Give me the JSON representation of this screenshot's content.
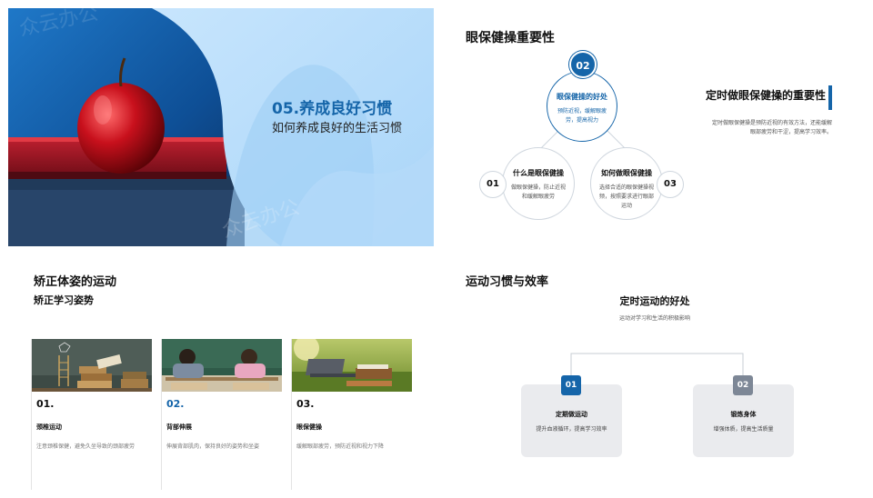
{
  "hero": {
    "watermark": "众云办公",
    "title": "05.养成良好习惯",
    "subtitle": "如何养成良好的生活习惯"
  },
  "importance": {
    "title": "眼保健操重要性",
    "nodes": [
      {
        "num": "01",
        "title": "什么是眼保健操",
        "desc": "做眼保健操，防止近视和缓解眼疲劳"
      },
      {
        "num": "02",
        "title": "眼保健操的好处",
        "desc": "预防近视，缓解眼疲劳，提高视力"
      },
      {
        "num": "03",
        "title": "如何做眼保健操",
        "desc": "选择合适的眼保健操视频，按照要求进行眼部运动"
      }
    ],
    "side_title": "定时做眼保健操的重要性",
    "side_text": "定时做眼保健操是预防近视的有效方法，还能缓解眼部疲劳和干涩，提高学习效率。"
  },
  "posture": {
    "title": "矫正体姿的运动",
    "subtitle": "矫正学习姿势",
    "cards": [
      {
        "num": "01.",
        "name": "颈椎运动",
        "desc": "注意颈椎保健，避免久坐导致的颈部疲劳"
      },
      {
        "num": "02.",
        "name": "背部伸展",
        "desc": "伸展背部肌肉，保持良好的姿势和坐姿"
      },
      {
        "num": "03.",
        "name": "眼保健操",
        "desc": "缓解眼部疲劳，预防近视和视力下降"
      }
    ]
  },
  "efficiency": {
    "title": "运动习惯与效率",
    "heading": "定时运动的好处",
    "subheading": "运动对学习和生活的积极影响",
    "items": [
      {
        "num": "01",
        "title": "定期做运动",
        "desc": "提升血液循环，提高学习效率"
      },
      {
        "num": "02",
        "title": "锻炼身体",
        "desc": "增强体质，提高生活质量"
      }
    ]
  },
  "colors": {
    "accent": "#1565a9",
    "grey_badge": "#7d8796",
    "light_blue": "#bfe0fb"
  }
}
